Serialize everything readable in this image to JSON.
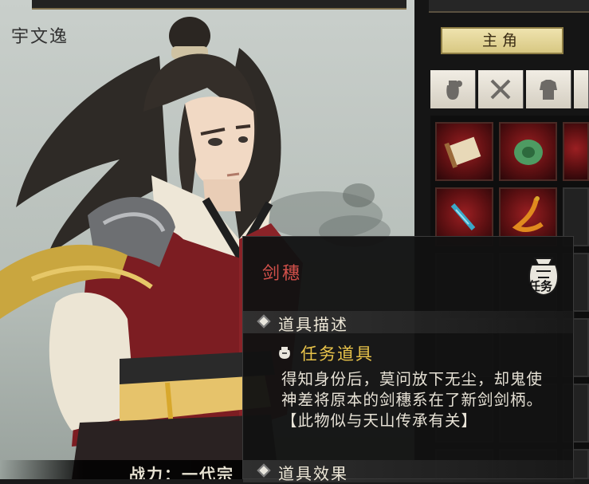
{
  "character": {
    "name": "宇文逸"
  },
  "footer": {
    "power_text": "战力：一代宗"
  },
  "sidebar": {
    "tab_label": "主角",
    "categories": [
      {
        "name": "bag-icon",
        "color": "#6d6a66"
      },
      {
        "name": "crossed-swords-icon",
        "color": "#6d6a66"
      },
      {
        "name": "armor-icon",
        "color": "#6d6a66"
      }
    ]
  },
  "tooltip": {
    "item_name": "剑穗",
    "badge_text": "任务",
    "sections": {
      "description_header": "道具描述",
      "effect_header": "道具效果"
    },
    "item_type": "任务道具",
    "description": "得知身份后，莫问放下无尘，却鬼使神差将原本的剑穗系在了新剑剑柄。【此物似与天山传承有关】"
  },
  "colors": {
    "item_name": "#d2504a",
    "item_type": "#e8c34a",
    "tab_gold": "#e3d497"
  }
}
